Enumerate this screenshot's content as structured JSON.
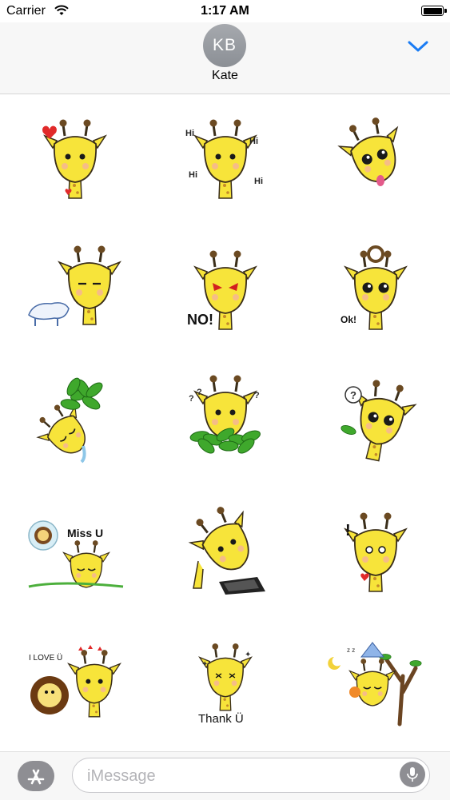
{
  "status_bar": {
    "carrier": "Carrier",
    "time": "1:17 AM"
  },
  "header": {
    "avatar_initials": "KB",
    "contact_name": "Kate"
  },
  "stickers": [
    {
      "icon": "giraffe-heart-sticker"
    },
    {
      "icon": "giraffe-hi-sticker",
      "text": "Hi"
    },
    {
      "icon": "giraffe-tongue-sticker"
    },
    {
      "icon": "giraffe-goat-sticker"
    },
    {
      "icon": "giraffe-angry-no-sticker",
      "text": "NO!"
    },
    {
      "icon": "giraffe-ok-sticker",
      "text": "Ok!"
    },
    {
      "icon": "giraffe-leaves-sticker"
    },
    {
      "icon": "giraffe-bush-hiding-sticker"
    },
    {
      "icon": "giraffe-question-sticker"
    },
    {
      "icon": "giraffe-miss-you-sticker",
      "text": "Miss U"
    },
    {
      "icon": "giraffe-tablet-sticker"
    },
    {
      "icon": "giraffe-surprised-sticker"
    },
    {
      "icon": "giraffe-love-lion-sticker",
      "text": "I LOVE Ü"
    },
    {
      "icon": "giraffe-thank-you-sticker",
      "text": "Thank  Ü"
    },
    {
      "icon": "giraffe-sleeping-tree-sticker"
    }
  ],
  "input_bar": {
    "placeholder": "iMessage"
  },
  "colors": {
    "accent": "#1a7cf4",
    "giraffe": "#f7e43a",
    "outline": "#3a2e1a"
  }
}
